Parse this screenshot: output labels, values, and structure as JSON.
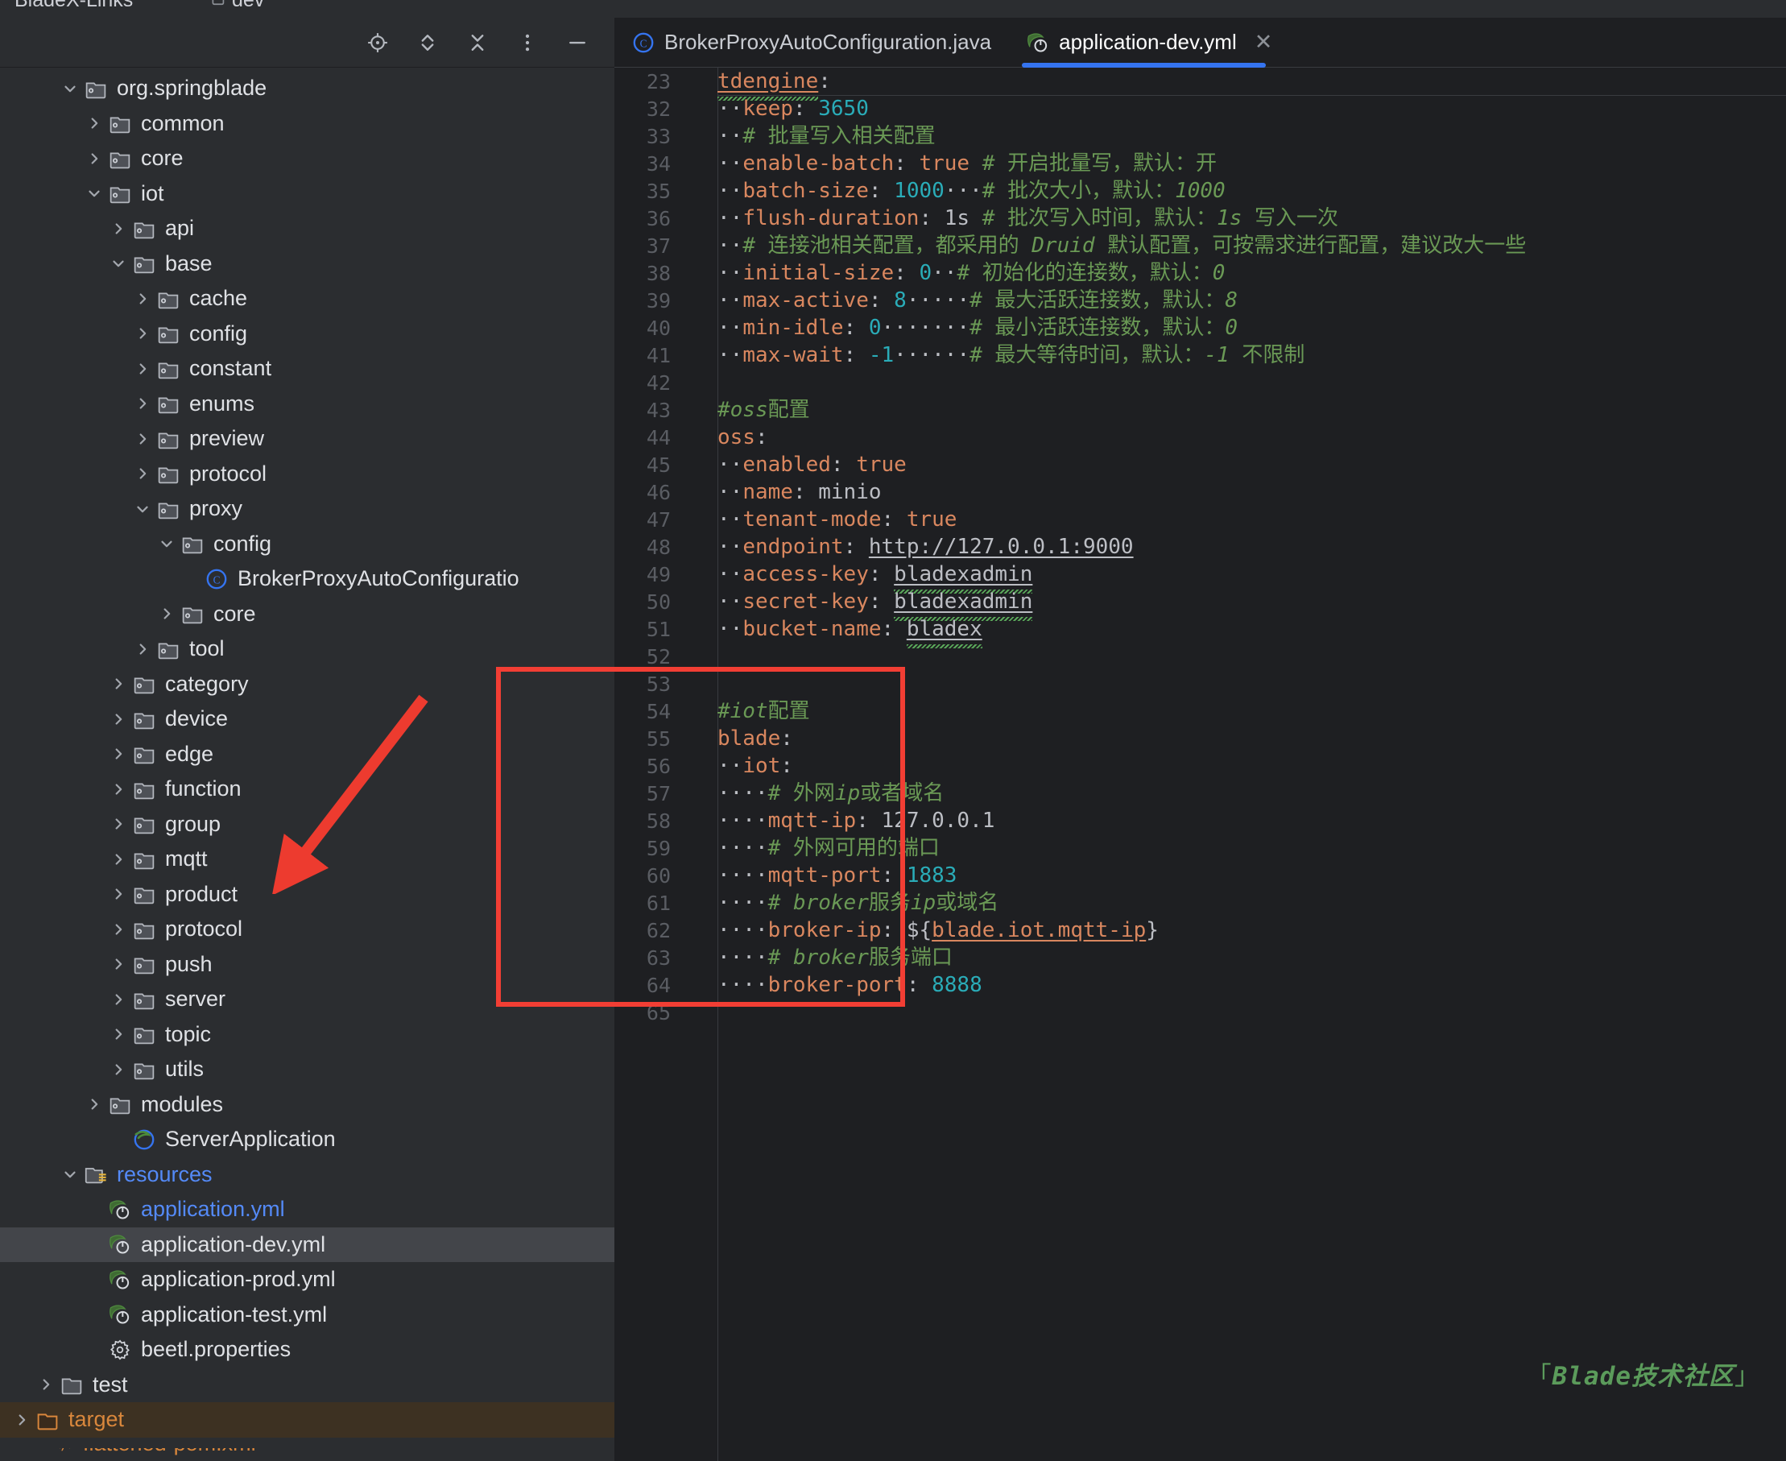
{
  "window": {
    "breadcrumb_project": "BladeX-Links",
    "breadcrumb_branch": "dev"
  },
  "project_toolbar": {
    "buttons": [
      {
        "name": "locate-icon",
        "label": "Select Opened File"
      },
      {
        "name": "expand-collapse-icon",
        "label": "Expand / Collapse"
      },
      {
        "name": "collapse-all-icon",
        "label": "Collapse All"
      },
      {
        "name": "more-options-icon",
        "label": "More Options"
      },
      {
        "name": "hide-icon",
        "label": "Hide"
      }
    ]
  },
  "tree": {
    "nodes": [
      {
        "label": "org.springblade",
        "icon": "package",
        "indent": 2,
        "state": "expanded"
      },
      {
        "label": "common",
        "icon": "package",
        "indent": 3,
        "state": "collapsed"
      },
      {
        "label": "core",
        "icon": "package",
        "indent": 3,
        "state": "collapsed"
      },
      {
        "label": "iot",
        "icon": "package",
        "indent": 3,
        "state": "expanded"
      },
      {
        "label": "api",
        "icon": "package",
        "indent": 4,
        "state": "collapsed"
      },
      {
        "label": "base",
        "icon": "package",
        "indent": 4,
        "state": "expanded"
      },
      {
        "label": "cache",
        "icon": "package",
        "indent": 5,
        "state": "collapsed"
      },
      {
        "label": "config",
        "icon": "package",
        "indent": 5,
        "state": "collapsed"
      },
      {
        "label": "constant",
        "icon": "package",
        "indent": 5,
        "state": "collapsed"
      },
      {
        "label": "enums",
        "icon": "package",
        "indent": 5,
        "state": "collapsed"
      },
      {
        "label": "preview",
        "icon": "package",
        "indent": 5,
        "state": "collapsed"
      },
      {
        "label": "protocol",
        "icon": "package",
        "indent": 5,
        "state": "collapsed"
      },
      {
        "label": "proxy",
        "icon": "package",
        "indent": 5,
        "state": "expanded"
      },
      {
        "label": "config",
        "icon": "package",
        "indent": 6,
        "state": "expanded"
      },
      {
        "label": "BrokerProxyAutoConfiguratio",
        "icon": "java-class",
        "indent": 7,
        "state": "leaf"
      },
      {
        "label": "core",
        "icon": "package",
        "indent": 6,
        "state": "collapsed"
      },
      {
        "label": "tool",
        "icon": "package",
        "indent": 5,
        "state": "collapsed"
      },
      {
        "label": "category",
        "icon": "package",
        "indent": 4,
        "state": "collapsed"
      },
      {
        "label": "device",
        "icon": "package",
        "indent": 4,
        "state": "collapsed"
      },
      {
        "label": "edge",
        "icon": "package",
        "indent": 4,
        "state": "collapsed"
      },
      {
        "label": "function",
        "icon": "package",
        "indent": 4,
        "state": "collapsed"
      },
      {
        "label": "group",
        "icon": "package",
        "indent": 4,
        "state": "collapsed"
      },
      {
        "label": "mqtt",
        "icon": "package",
        "indent": 4,
        "state": "collapsed"
      },
      {
        "label": "product",
        "icon": "package",
        "indent": 4,
        "state": "collapsed"
      },
      {
        "label": "protocol",
        "icon": "package",
        "indent": 4,
        "state": "collapsed"
      },
      {
        "label": "push",
        "icon": "package",
        "indent": 4,
        "state": "collapsed"
      },
      {
        "label": "server",
        "icon": "package",
        "indent": 4,
        "state": "collapsed"
      },
      {
        "label": "topic",
        "icon": "package",
        "indent": 4,
        "state": "collapsed"
      },
      {
        "label": "utils",
        "icon": "package",
        "indent": 4,
        "state": "collapsed"
      },
      {
        "label": "modules",
        "icon": "package",
        "indent": 3,
        "state": "collapsed"
      },
      {
        "label": "ServerApplication",
        "icon": "spring-class",
        "indent": 4,
        "state": "leaf"
      },
      {
        "label": "resources",
        "icon": "resources-folder",
        "indent": 2,
        "state": "expanded",
        "color": "blue"
      },
      {
        "label": "application.yml",
        "icon": "spring-yml",
        "indent": 3,
        "state": "leaf",
        "color": "blue"
      },
      {
        "label": "application-dev.yml",
        "icon": "spring-yml",
        "indent": 3,
        "state": "leaf",
        "selected": true
      },
      {
        "label": "application-prod.yml",
        "icon": "spring-yml",
        "indent": 3,
        "state": "leaf"
      },
      {
        "label": "application-test.yml",
        "icon": "spring-yml",
        "indent": 3,
        "state": "leaf"
      },
      {
        "label": "beetl.properties",
        "icon": "properties",
        "indent": 3,
        "state": "leaf"
      },
      {
        "label": "test",
        "icon": "folder",
        "indent": 1,
        "state": "collapsed"
      },
      {
        "label": "target",
        "icon": "folder-excluded",
        "indent": 0,
        "state": "collapsed",
        "color": "orange",
        "highlight": "target"
      },
      {
        "label": "flattened-pom.xml",
        "icon": "xml",
        "indent": 1,
        "state": "leaf",
        "color": "orange"
      }
    ]
  },
  "editor": {
    "tabs": [
      {
        "label": "BrokerProxyAutoConfiguration.java",
        "icon": "java-class-icon",
        "active": false,
        "closable": false
      },
      {
        "label": "application-dev.yml",
        "icon": "spring-yml-icon",
        "active": true,
        "closable": true,
        "close_glyph": "✕"
      }
    ],
    "lines": [
      {
        "no": "23",
        "fold_before": false,
        "tokens": [
          {
            "t": "tdengine",
            "c": "k u sp"
          },
          {
            "t": ":",
            "c": "p"
          }
        ]
      },
      {
        "no": "32",
        "fold_before": true,
        "tokens": [
          {
            "t": "··",
            "c": "p"
          },
          {
            "t": "keep",
            "c": "k"
          },
          {
            "t": ": ",
            "c": "p"
          },
          {
            "t": "3650",
            "c": "n"
          }
        ]
      },
      {
        "no": "33",
        "tokens": [
          {
            "t": "··",
            "c": "p"
          },
          {
            "t": "# 批量写入相关配置",
            "c": "c"
          }
        ]
      },
      {
        "no": "34",
        "tokens": [
          {
            "t": "··",
            "c": "p"
          },
          {
            "t": "enable-batch",
            "c": "k"
          },
          {
            "t": ": ",
            "c": "p"
          },
          {
            "t": "true",
            "c": "k"
          },
          {
            "t": " ",
            "c": "p"
          },
          {
            "t": "# 开启批量写，默认：开",
            "c": "c"
          }
        ]
      },
      {
        "no": "35",
        "tokens": [
          {
            "t": "··",
            "c": "p"
          },
          {
            "t": "batch-size",
            "c": "k"
          },
          {
            "t": ": ",
            "c": "p"
          },
          {
            "t": "1000",
            "c": "n"
          },
          {
            "t": "···",
            "c": "p"
          },
          {
            "t": "# 批次大小，默认：",
            "c": "c"
          },
          {
            "t": "1000",
            "c": "ci"
          }
        ]
      },
      {
        "no": "36",
        "tokens": [
          {
            "t": "··",
            "c": "p"
          },
          {
            "t": "flush-duration",
            "c": "k"
          },
          {
            "t": ": ",
            "c": "p"
          },
          {
            "t": "1s",
            "c": "s"
          },
          {
            "t": " ",
            "c": "p"
          },
          {
            "t": "# 批次写入时间，默认：",
            "c": "c"
          },
          {
            "t": "1s",
            "c": "ci"
          },
          {
            "t": " 写入一次",
            "c": "c"
          }
        ]
      },
      {
        "no": "37",
        "tokens": [
          {
            "t": "··",
            "c": "p"
          },
          {
            "t": "# 连接池相关配置，都采用的 ",
            "c": "c"
          },
          {
            "t": "Druid",
            "c": "ci"
          },
          {
            "t": " 默认配置，可按需求进行配置，建议改大一些",
            "c": "c"
          }
        ]
      },
      {
        "no": "38",
        "tokens": [
          {
            "t": "··",
            "c": "p"
          },
          {
            "t": "initial-size",
            "c": "k"
          },
          {
            "t": ": ",
            "c": "p"
          },
          {
            "t": "0",
            "c": "n"
          },
          {
            "t": "··",
            "c": "p"
          },
          {
            "t": "# 初始化的连接数，默认：",
            "c": "c"
          },
          {
            "t": "0",
            "c": "ci"
          }
        ]
      },
      {
        "no": "39",
        "tokens": [
          {
            "t": "··",
            "c": "p"
          },
          {
            "t": "max-active",
            "c": "k"
          },
          {
            "t": ": ",
            "c": "p"
          },
          {
            "t": "8",
            "c": "n"
          },
          {
            "t": "·····",
            "c": "p"
          },
          {
            "t": "# 最大活跃连接数，默认：",
            "c": "c"
          },
          {
            "t": "8",
            "c": "ci"
          }
        ]
      },
      {
        "no": "40",
        "tokens": [
          {
            "t": "··",
            "c": "p"
          },
          {
            "t": "min-idle",
            "c": "k"
          },
          {
            "t": ": ",
            "c": "p"
          },
          {
            "t": "0",
            "c": "n"
          },
          {
            "t": "·······",
            "c": "p"
          },
          {
            "t": "# 最小活跃连接数，默认：",
            "c": "c"
          },
          {
            "t": "0",
            "c": "ci"
          }
        ]
      },
      {
        "no": "41",
        "tokens": [
          {
            "t": "··",
            "c": "p"
          },
          {
            "t": "max-wait",
            "c": "k"
          },
          {
            "t": ": ",
            "c": "p"
          },
          {
            "t": "-1",
            "c": "n"
          },
          {
            "t": "······",
            "c": "p"
          },
          {
            "t": "# 最大等待时间，默认：",
            "c": "c"
          },
          {
            "t": "-1",
            "c": "ci"
          },
          {
            "t": " 不限制",
            "c": "c"
          }
        ]
      },
      {
        "no": "42",
        "tokens": []
      },
      {
        "no": "43",
        "tokens": [
          {
            "t": "#",
            "c": "c"
          },
          {
            "t": "oss",
            "c": "ci"
          },
          {
            "t": "配置",
            "c": "c"
          }
        ]
      },
      {
        "no": "44",
        "tokens": [
          {
            "t": "oss",
            "c": "k"
          },
          {
            "t": ":",
            "c": "p"
          }
        ]
      },
      {
        "no": "45",
        "tokens": [
          {
            "t": "··",
            "c": "p"
          },
          {
            "t": "enabled",
            "c": "k"
          },
          {
            "t": ": ",
            "c": "p"
          },
          {
            "t": "true",
            "c": "k"
          }
        ]
      },
      {
        "no": "46",
        "tokens": [
          {
            "t": "··",
            "c": "p"
          },
          {
            "t": "name",
            "c": "k"
          },
          {
            "t": ": ",
            "c": "p"
          },
          {
            "t": "minio",
            "c": "s"
          }
        ]
      },
      {
        "no": "47",
        "tokens": [
          {
            "t": "··",
            "c": "p"
          },
          {
            "t": "tenant-mode",
            "c": "k"
          },
          {
            "t": ": ",
            "c": "p"
          },
          {
            "t": "true",
            "c": "k"
          }
        ]
      },
      {
        "no": "48",
        "tokens": [
          {
            "t": "··",
            "c": "p"
          },
          {
            "t": "endpoint",
            "c": "k"
          },
          {
            "t": ": ",
            "c": "p"
          },
          {
            "t": "http://127.0.0.1:9000",
            "c": "s u"
          }
        ]
      },
      {
        "no": "49",
        "tokens": [
          {
            "t": "··",
            "c": "p"
          },
          {
            "t": "access-key",
            "c": "k"
          },
          {
            "t": ": ",
            "c": "p"
          },
          {
            "t": "bladexadmin",
            "c": "s u sp"
          }
        ]
      },
      {
        "no": "50",
        "tokens": [
          {
            "t": "··",
            "c": "p"
          },
          {
            "t": "secret-key",
            "c": "k"
          },
          {
            "t": ": ",
            "c": "p"
          },
          {
            "t": "bladexadmin",
            "c": "s u sp"
          }
        ]
      },
      {
        "no": "51",
        "tokens": [
          {
            "t": "··",
            "c": "p"
          },
          {
            "t": "bucket-name",
            "c": "k"
          },
          {
            "t": ": ",
            "c": "p"
          },
          {
            "t": "bladex",
            "c": "s u sp"
          }
        ]
      },
      {
        "no": "52",
        "tokens": []
      },
      {
        "no": "53",
        "tokens": []
      },
      {
        "no": "54",
        "tokens": [
          {
            "t": "#",
            "c": "c"
          },
          {
            "t": "iot",
            "c": "ci"
          },
          {
            "t": "配置",
            "c": "c"
          }
        ]
      },
      {
        "no": "55",
        "tokens": [
          {
            "t": "blade",
            "c": "k"
          },
          {
            "t": ":",
            "c": "p"
          }
        ]
      },
      {
        "no": "56",
        "tokens": [
          {
            "t": "··",
            "c": "p"
          },
          {
            "t": "iot",
            "c": "k"
          },
          {
            "t": ":",
            "c": "p"
          }
        ]
      },
      {
        "no": "57",
        "tokens": [
          {
            "t": "····",
            "c": "p"
          },
          {
            "t": "# 外网",
            "c": "c"
          },
          {
            "t": "ip",
            "c": "ci"
          },
          {
            "t": "或者域名",
            "c": "c"
          }
        ]
      },
      {
        "no": "58",
        "tokens": [
          {
            "t": "····",
            "c": "p"
          },
          {
            "t": "mqtt-ip",
            "c": "k"
          },
          {
            "t": ": ",
            "c": "p"
          },
          {
            "t": "127.0.0.1",
            "c": "s"
          }
        ]
      },
      {
        "no": "59",
        "tokens": [
          {
            "t": "····",
            "c": "p"
          },
          {
            "t": "# 外网可用的端口",
            "c": "c"
          }
        ]
      },
      {
        "no": "60",
        "tokens": [
          {
            "t": "····",
            "c": "p"
          },
          {
            "t": "mqtt-port",
            "c": "k"
          },
          {
            "t": ": ",
            "c": "p"
          },
          {
            "t": "1883",
            "c": "n"
          }
        ]
      },
      {
        "no": "61",
        "tokens": [
          {
            "t": "····",
            "c": "p"
          },
          {
            "t": "# ",
            "c": "c"
          },
          {
            "t": "broker",
            "c": "ci"
          },
          {
            "t": "服务",
            "c": "c"
          },
          {
            "t": "ip",
            "c": "ci"
          },
          {
            "t": "或域名",
            "c": "c"
          }
        ]
      },
      {
        "no": "62",
        "tokens": [
          {
            "t": "····",
            "c": "p"
          },
          {
            "t": "broker-ip",
            "c": "k"
          },
          {
            "t": ": ",
            "c": "p"
          },
          {
            "t": "${",
            "c": "p"
          },
          {
            "t": "blade.iot.mqtt-ip",
            "c": "k u"
          },
          {
            "t": "}",
            "c": "p"
          }
        ]
      },
      {
        "no": "63",
        "tokens": [
          {
            "t": "····",
            "c": "p"
          },
          {
            "t": "# ",
            "c": "c"
          },
          {
            "t": "broker",
            "c": "ci"
          },
          {
            "t": "服务端口",
            "c": "c"
          }
        ]
      },
      {
        "no": "64",
        "tokens": [
          {
            "t": "····",
            "c": "p"
          },
          {
            "t": "broker-port",
            "c": "k"
          },
          {
            "t": ": ",
            "c": "p"
          },
          {
            "t": "8888",
            "c": "n"
          }
        ]
      },
      {
        "no": "65",
        "tokens": []
      }
    ]
  },
  "annotations": {
    "highlight_box_color": "#f23e34",
    "arrow_color": "#ed3b2f",
    "watermark_prefix": "「",
    "watermark_text": "Blade技术社区",
    "watermark_suffix": "」",
    "watermark_color": "#5b9b5b"
  }
}
